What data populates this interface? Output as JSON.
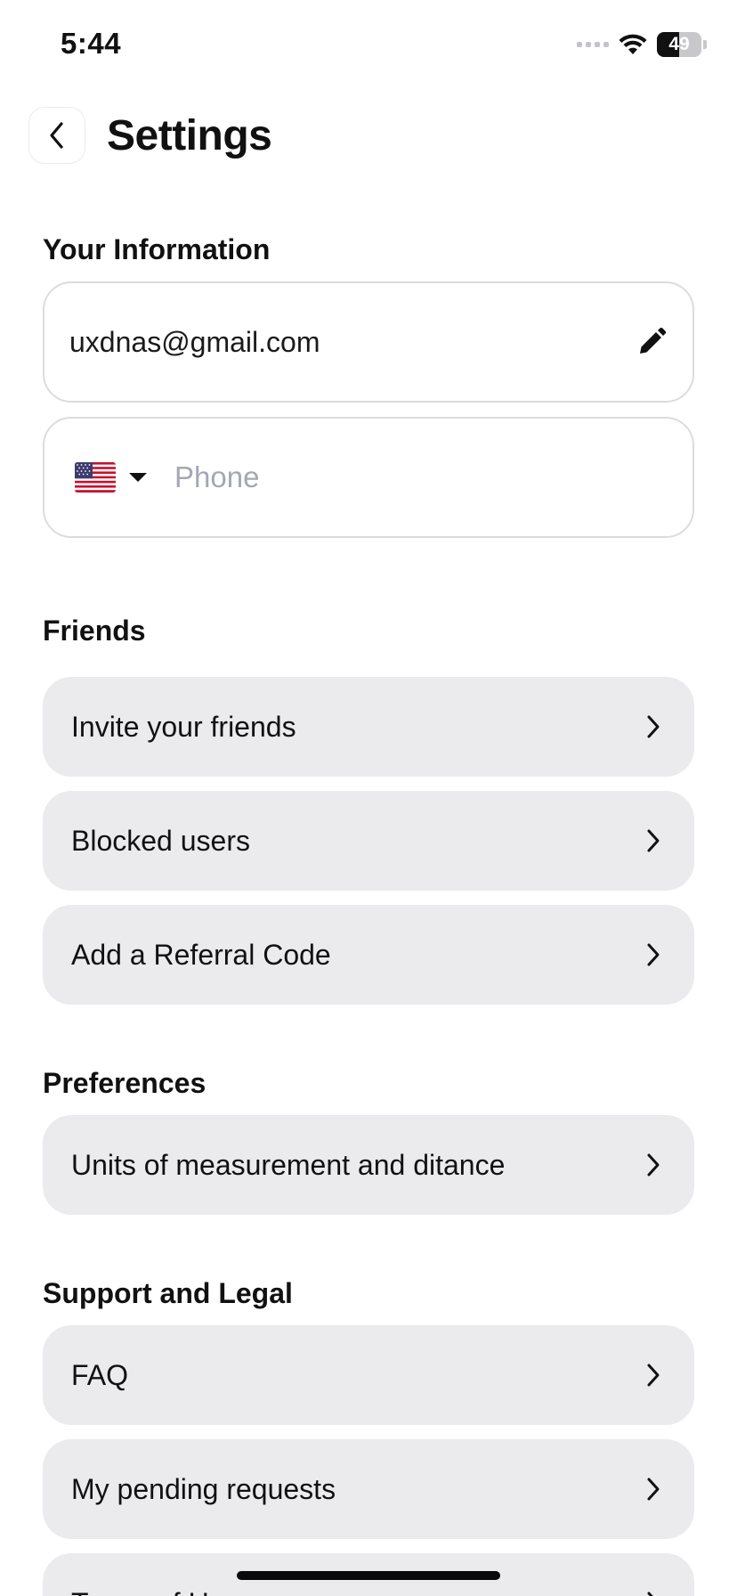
{
  "status_bar": {
    "time": "5:44",
    "battery_percent": "49",
    "battery_level": 0.49,
    "icons": [
      "cellular-signal-icon",
      "wifi-icon",
      "battery-icon"
    ]
  },
  "header": {
    "title": "Settings",
    "back_icon": "chevron-left-icon"
  },
  "your_information": {
    "title": "Your Information",
    "email": "uxdnas@gmail.com",
    "edit_icon": "pencil-icon",
    "phone": {
      "country_flag_icon": "us-flag-icon",
      "dropdown_icon": "caret-down-icon",
      "value": "",
      "placeholder": "Phone"
    }
  },
  "friends": {
    "title": "Friends",
    "items": [
      {
        "label": "Invite your friends"
      },
      {
        "label": "Blocked users"
      },
      {
        "label": "Add a Referral Code"
      }
    ]
  },
  "preferences": {
    "title": "Preferences",
    "items": [
      {
        "label": "Units of measurement and ditance"
      }
    ]
  },
  "support_legal": {
    "title": "Support and Legal",
    "items": [
      {
        "label": "FAQ"
      },
      {
        "label": "My pending requests"
      },
      {
        "label": "Terms of Use"
      }
    ]
  },
  "colors": {
    "row_background": "#ebebee",
    "field_border": "#dcdcdf",
    "placeholder": "#a3a8b3",
    "text": "#111111"
  }
}
